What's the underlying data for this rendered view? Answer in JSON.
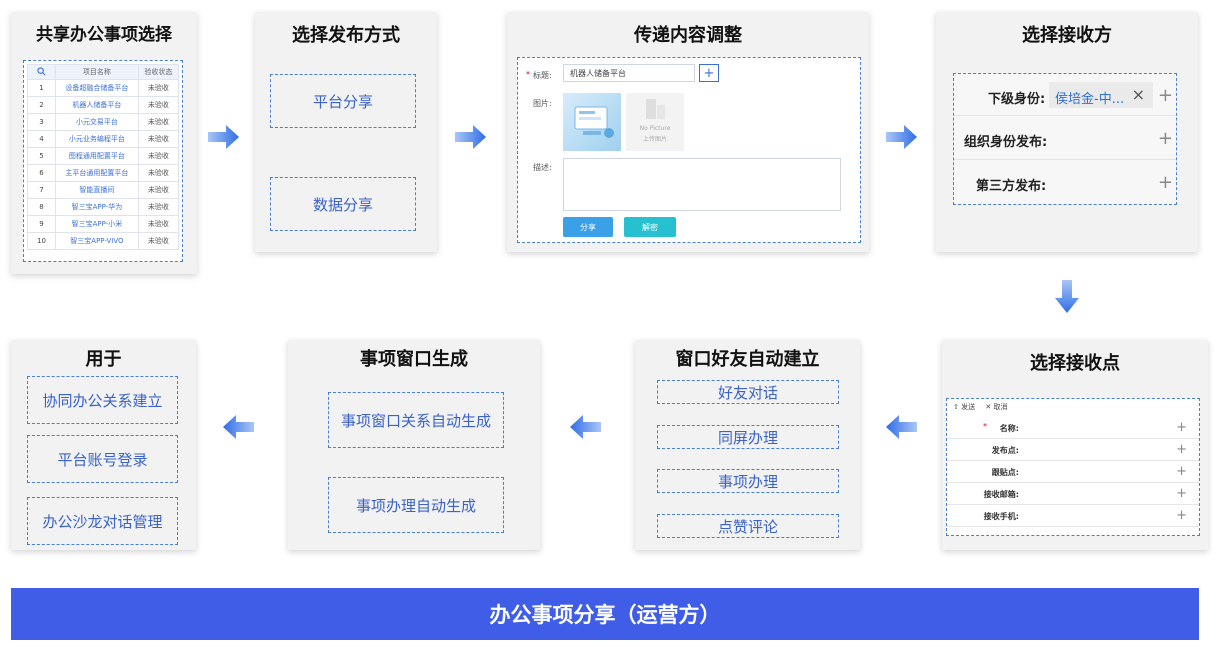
{
  "step1": {
    "title": "共享办公事项选择",
    "columns": [
      "项目名称",
      "验收状态"
    ],
    "rows": [
      {
        "no": "1",
        "name": "设备超融合储备平台",
        "status": "未验收"
      },
      {
        "no": "2",
        "name": "机器人储备平台",
        "status": "未验收"
      },
      {
        "no": "3",
        "name": "小元交易平台",
        "status": "未验收"
      },
      {
        "no": "4",
        "name": "小元业务编程平台",
        "status": "未验收"
      },
      {
        "no": "5",
        "name": "图程通用配置平台",
        "status": "未验收"
      },
      {
        "no": "6",
        "name": "主平台通用配置平台",
        "status": "未验收"
      },
      {
        "no": "7",
        "name": "智能直播间",
        "status": "未验收"
      },
      {
        "no": "8",
        "name": "智三宝APP-华为",
        "status": "未验收"
      },
      {
        "no": "9",
        "name": "智三宝APP-小米",
        "status": "未验收"
      },
      {
        "no": "10",
        "name": "智三宝APP-VIVO",
        "status": "未验收"
      }
    ]
  },
  "step2": {
    "title": "选择发布方式",
    "options": [
      "平台分享",
      "数据分享"
    ]
  },
  "step3": {
    "title": "传递内容调整",
    "required_mark": "*",
    "title_label": "标题:",
    "title_value": "机器人储备平台",
    "add_symbol": "+",
    "image_label": "图片:",
    "no_picture": "No Picture",
    "upload_text": "上传图片",
    "desc_label": "描述:",
    "share_btn": "分享",
    "cancel_btn": "解密"
  },
  "step4": {
    "title": "选择接收方",
    "rows": [
      {
        "label": "下级身份:",
        "tag": "侯培金-中...",
        "close": "×",
        "plus": "+"
      },
      {
        "label": "组织身份发布:",
        "plus": "+"
      },
      {
        "label": "第三方发布:",
        "plus": "+"
      }
    ]
  },
  "step5": {
    "title": "选择接收点",
    "send_label": "发送",
    "cancel_label": "取消",
    "required_mark": "*",
    "fields": [
      "名称:",
      "发布点:",
      "跟贴点:",
      "接收邮箱:",
      "接收手机:"
    ],
    "plus": "+"
  },
  "step6": {
    "title": "窗口好友自动建立",
    "items": [
      "好友对话",
      "同屏办理",
      "事项办理",
      "点赞评论"
    ]
  },
  "step7": {
    "title": "事项窗口生成",
    "items": [
      "事项窗口关系自动生成",
      "事项办理自动生成"
    ]
  },
  "step8": {
    "title": "用于",
    "items": [
      "协同办公关系建立",
      "平台账号登录",
      "办公沙龙对话管理"
    ]
  },
  "banner": "办公事项分享（运营方）",
  "colors": {
    "accent": "#3f5de6",
    "dash": "#4a7fd0",
    "arrow": "#3d7be8",
    "share_btn": "#3aa0e8",
    "cancel_btn": "#27c0d0"
  }
}
